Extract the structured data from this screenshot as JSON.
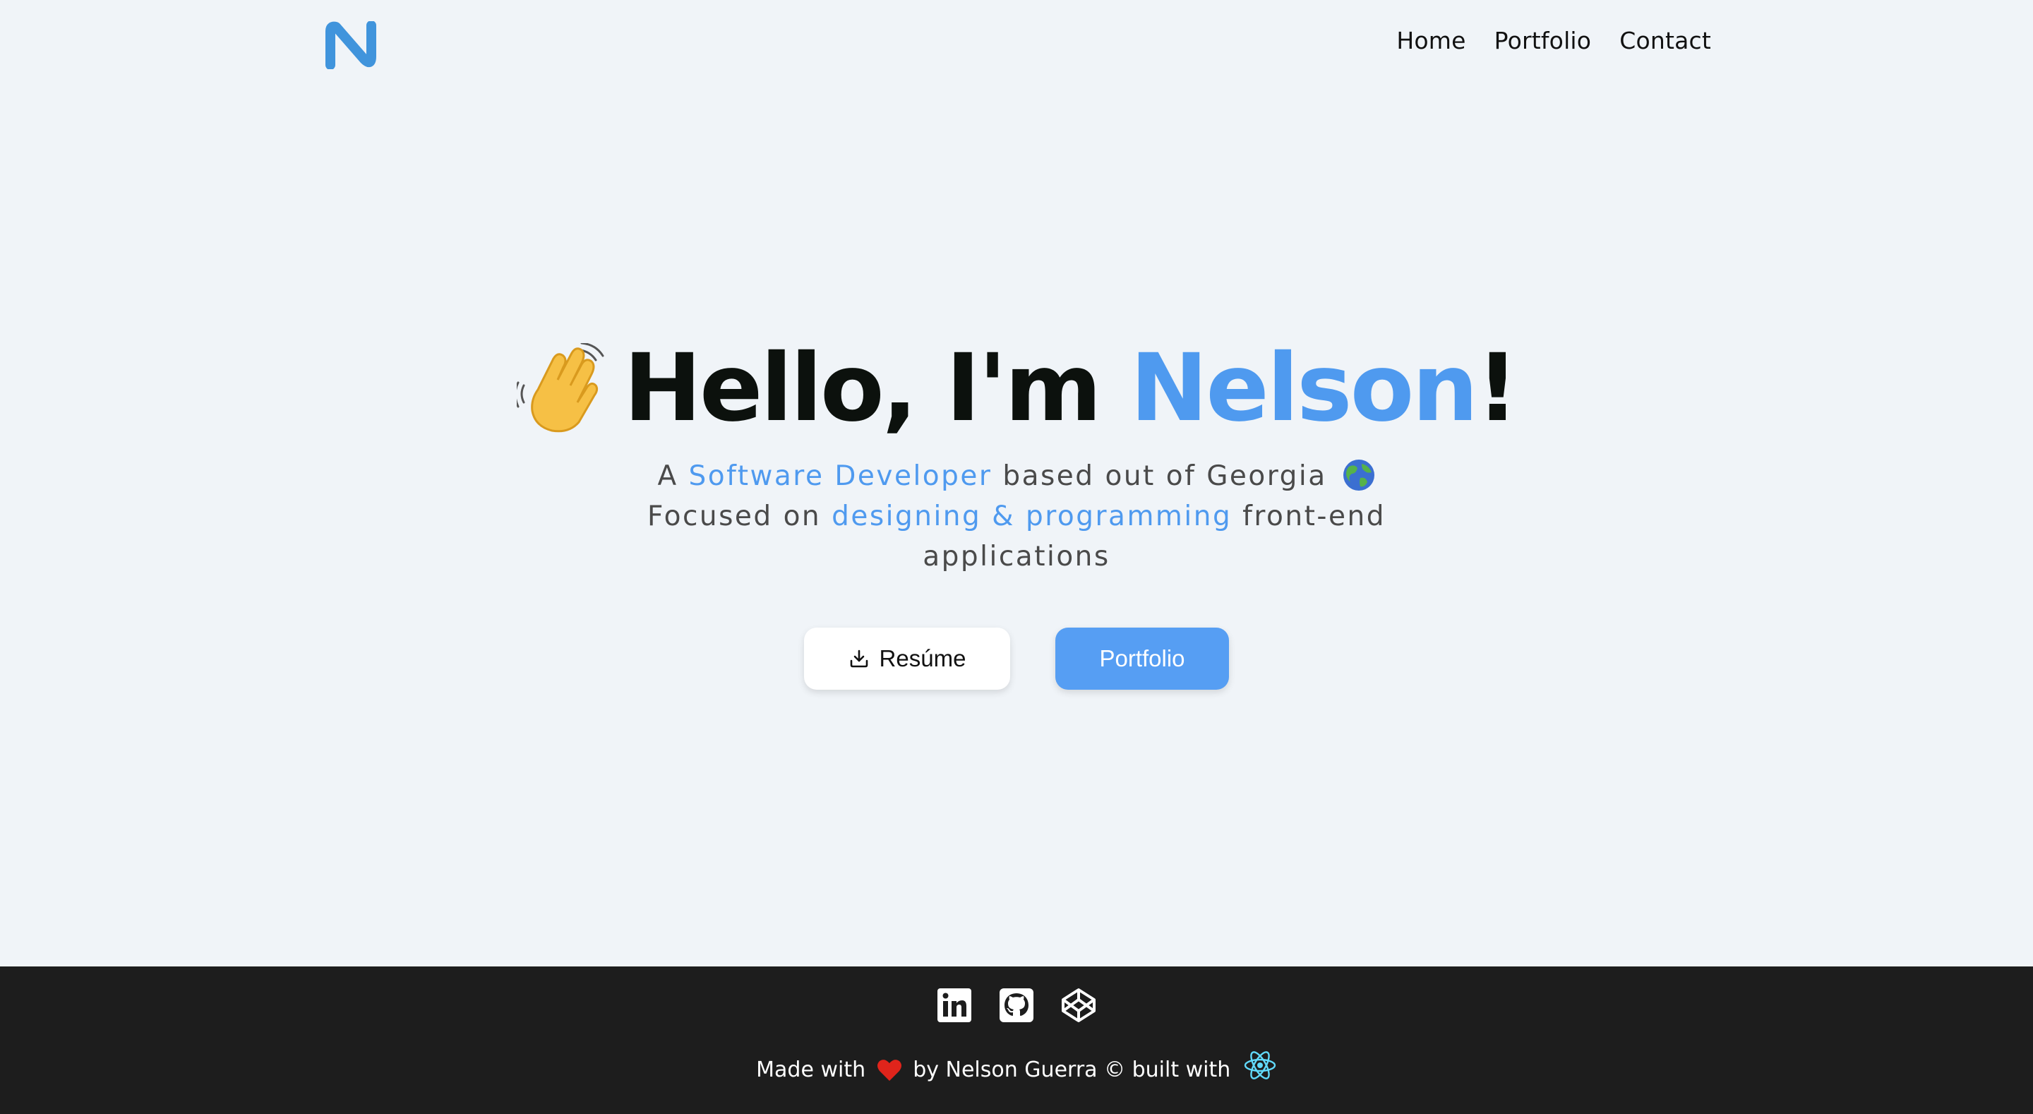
{
  "header": {
    "logo_letter": "N",
    "nav": [
      {
        "label": "Home"
      },
      {
        "label": "Portfolio"
      },
      {
        "label": "Contact"
      }
    ]
  },
  "hero": {
    "greeting_prefix": "Hello, I'm ",
    "name": "Nelson",
    "greeting_suffix": "!",
    "wave_icon": "waving-hand-icon",
    "line1_prefix": "A ",
    "line1_accent": "Software Developer",
    "line1_suffix": " based out of Georgia",
    "globe_icon": "globe-icon",
    "line2_prefix": "Focused on ",
    "line2_accent": "designing & programming",
    "line2_suffix": " front-end applications"
  },
  "buttons": {
    "resume_label": "Resúme",
    "resume_icon": "download-icon",
    "portfolio_label": "Portfolio"
  },
  "footer": {
    "socials": [
      "linkedin-icon",
      "github-icon",
      "codepen-icon"
    ],
    "credit_prefix": "Made with",
    "credit_middle": "by Nelson Guerra © built with",
    "heart_icon": "heart-icon",
    "react_icon": "react-icon"
  },
  "colors": {
    "background": "#f0f4f8",
    "accent": "#4f9aef",
    "button_primary": "#569ef3",
    "footer": "#1d1d1d"
  }
}
